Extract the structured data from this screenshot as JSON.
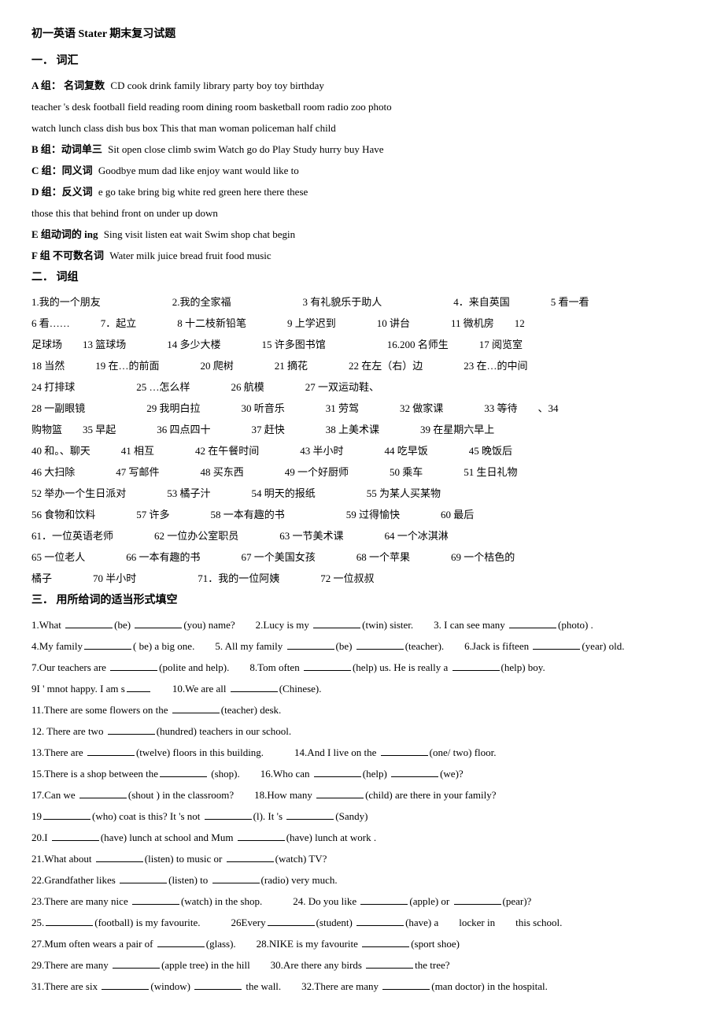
{
  "title": "初一英语  Stater  期末复习试题",
  "section1": "一．   词汇",
  "groupA_label": "A 组：  名词复数",
  "groupA_words": "CD    cook    drink    family    library    party    boy    toy    birthday",
  "groupA_words2": "teacher 's desk    football field       reading room    dining room      basketball room    radio    zoo    photo",
  "groupA_words3": "watch    lunch    class    dish    bus    box    This    that    man    woman    policeman    half    child",
  "groupB_label": "B 组：动词单三",
  "groupB_words": "Sit    open    close    climb    swim    Watch    go    do    Play   Study   hurry    buy    Have",
  "groupC_label": "C 组：同义词",
  "groupC_words": "Goodbye       mum        dad        like         enjoy        want        would like to",
  "groupD_label": "D 组：反义词",
  "groupD_words": "e    go    take    bring    big    white    red    green    here    there    these",
  "groupD_words2": "those    this    that    behind    front    on    under    up    down",
  "groupE_label": "E 组动词的 ing",
  "groupE_words": "Sing    visit    listen    eat    wait    Swim    shop    chat    begin",
  "groupF_label": "F 组  不可数名词",
  "groupF_words": "Water    milk    juice    bread    fruit    food    music",
  "section2": "二．   词组",
  "phrases": [
    "1.我的一个朋友",
    "2.我的全家福",
    "3 有礼貌乐于助人",
    "4．来自英国",
    "5 看一看",
    "6 看……",
    "7．起立",
    "8 十二枝新铅笔",
    "9 上学迟到",
    "10 讲台",
    "11 微机房",
    "12",
    "足球场",
    "13 篮球场",
    "14 多少大楼",
    "15 许多图书馆",
    "16.200 名师生",
    "17 阅览室",
    "18 当然",
    "19 在…的前面",
    "20 爬树",
    "21 摘花",
    "22 在左（右）边",
    "23 在…的中间",
    "28 一副眼镜",
    "29 我明白拉",
    "30 听音乐",
    "31 劳驾",
    "32 做家课",
    "33 等待",
    "、34",
    "购物篮",
    "35 早起",
    "36 四点四十",
    "37 赶快",
    "38 上美术课",
    "39 在星期六早上",
    "40 和。、聊天",
    "41 相互",
    "42 在午餐时间",
    "43 半小时",
    "44 吃早饭",
    "45 晚饭后",
    "46 大扫除",
    "47 写邮件",
    "48 买东西",
    "49 一个好厨师",
    "50 乘车",
    "51 生日礼物",
    "52 举办一个生日派对",
    "53 橘子汁",
    "54 明天的报纸",
    "55 为某人买某物",
    "56 食物和饮料",
    "57 许多",
    "58 一本有趣的书",
    "59 过得愉快",
    "60 最后",
    "61．一位英语老师",
    "62 一位办公室职员",
    "63 一节美术课",
    "64 一个冰淇淋",
    "65 一位老人",
    "66 一本有趣的书",
    "67 一个美国女孩",
    "68 一个苹果",
    "69 一个桔色的",
    "橘子",
    "70 半小时",
    "71．我的一位阿姨",
    "72 一位叔叔",
    "24 打排球",
    "25 …怎么样",
    "26 航模",
    "27 一双运动鞋、"
  ],
  "section3": "三．   用所给词的适当形式填空",
  "fill_lines": [
    "1.What _______(be) ________(you) name?    2.Lucy is my ________(twin) sister.    3. I can see many ________(photo) .",
    "4.My family________(be) a big one.    5. All my family ____(be) ___(teacher).    6.Jack is fifteen ________(year) old.",
    "7.Our teachers are ________(polite and help).    8.Tom often ______(help) us. He is really a ______(help) boy.",
    "9I ' mnot happy. I am s___    10.We are all __________(Chinese).",
    "11.There are some flowers on the ________(teacher) desk.",
    "12. There are two ________(hundred) teachers in our school.",
    "13.There are ________(twelve) floors in this building.    14.And I live on the ________(one/ two) floor.",
    "15.There is a shop between the________(shop).    16.Who can ______(help) ______(we)?",
    "17.Can we ________(shout ) in the classroom?    18.How many ______(child) are there in your family?",
    "19_______(who) coat is this? It 's not ________(l). It 's ______(Sandy)",
    "20.I _____(have) lunch at school and Mum _____(have) lunch at work .",
    "21.What about _____(listen) to music or _______(watch) TV?",
    "22.Grandfather likes ________(listen) to ________(radio) very much.",
    "23.There are many nice ________(watch) in the shop.    24. Do you like ______(apple) or _____(pear)?",
    "25.________(football) is my favourite.    26Every________(student) _____(have) a   locker in   this school.",
    "27.Mum often wears a pair of ______(glass).    28.NIKE is my favourite ________(sport shoe)",
    "29.There are many ________(apple tree) in the hill    30.Are there any birds ______the tree?",
    "31.There are six ______(window) _____ the wall.    32.There are many ________(man doctor) in the hospital."
  ]
}
